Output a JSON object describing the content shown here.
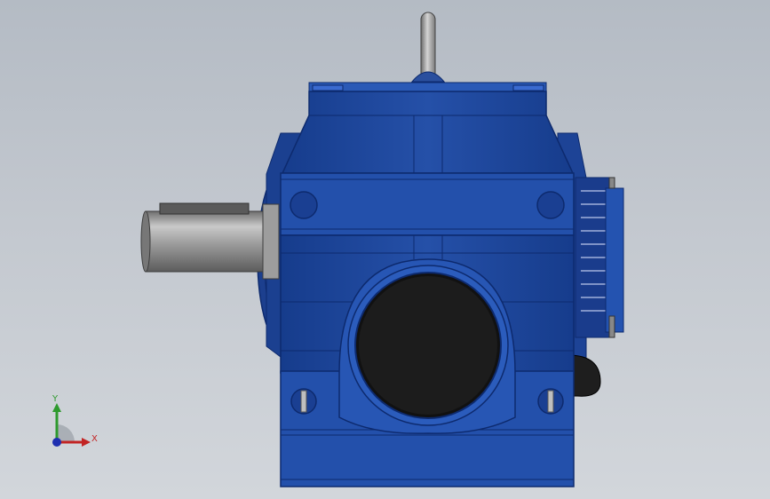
{
  "viewport": {
    "background_top": "#b4bbc4",
    "background_bottom": "#d2d6db"
  },
  "model": {
    "body_color": "#1f4aa0",
    "body_dark": "#0d2a6e",
    "body_light": "#3563c4",
    "shaft_color": "#8c8c8c",
    "bore_color": "#1a1a1a"
  },
  "triad": {
    "y_label": "Y",
    "x_label": "X",
    "y_color": "#2e9a2e",
    "x_color": "#c22424",
    "z_color": "#1e2fb0"
  }
}
